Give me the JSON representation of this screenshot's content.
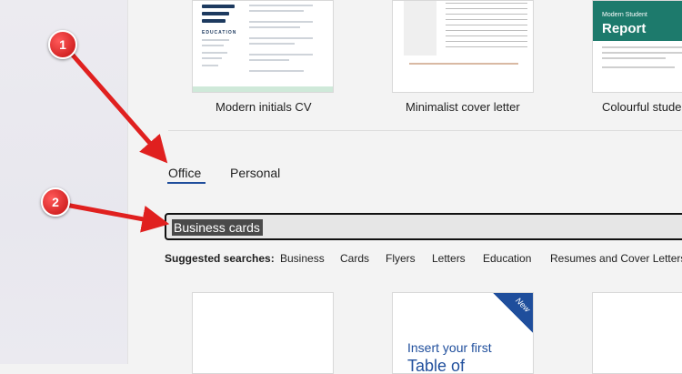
{
  "templates_top": [
    {
      "name": "Modern initials CV"
    },
    {
      "name": "Minimalist cover letter"
    },
    {
      "name": "Colourful studen"
    }
  ],
  "cv_thumb": {
    "section_heading": "EDUCATION"
  },
  "report_thumb": {
    "subtitle": "Modern Student",
    "title": "Report"
  },
  "tabs": [
    {
      "label": "Office",
      "selected": true
    },
    {
      "label": "Personal",
      "selected": false
    }
  ],
  "search": {
    "value": "Business cards"
  },
  "suggested": {
    "label": "Suggested searches:",
    "items": [
      "Business",
      "Cards",
      "Flyers",
      "Letters",
      "Education",
      "Resumes and Cover Letters"
    ]
  },
  "templates_bottom": {
    "new_badge": "New",
    "toc_line": "Insert your first",
    "toc_line2": "Table of"
  },
  "annotations": [
    {
      "number": "1"
    },
    {
      "number": "2"
    }
  ],
  "colors": {
    "accent": "#1f4e9c",
    "annotation": "#e0201f",
    "report_band": "#1d7a6c"
  }
}
